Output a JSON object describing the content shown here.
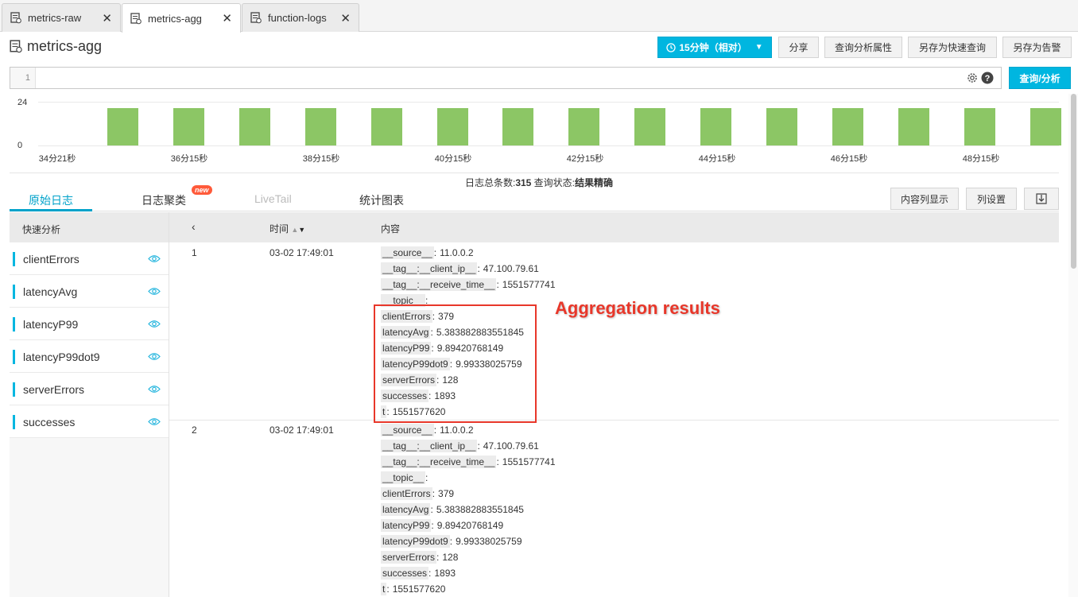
{
  "tabs": [
    {
      "label": "metrics-raw"
    },
    {
      "label": "metrics-agg"
    },
    {
      "label": "function-logs"
    }
  ],
  "header": {
    "title": "metrics-agg",
    "time_button": "15分钟（相对）",
    "share": "分享",
    "query_props": "查询分析属性",
    "save_quick": "另存为快速查询",
    "save_alert": "另存为告警"
  },
  "query": {
    "line_no": "1",
    "value": "",
    "submit": "查询/分析"
  },
  "histogram": {
    "y_ticks": [
      "24",
      "0"
    ],
    "x_ticks": [
      "34分21秒",
      "36分15秒",
      "38分15秒",
      "40分15秒",
      "42分15秒",
      "44分15秒",
      "46分15秒",
      "48分15秒"
    ],
    "bar_values": [
      24,
      24,
      24,
      24,
      24,
      24,
      24,
      24,
      24,
      24,
      24,
      24,
      24,
      24,
      24
    ],
    "bar_color": "#8cc665"
  },
  "summary": {
    "count_label": "日志总条数:",
    "count": "315",
    "status_label": " 查询状态:",
    "status": "结果精确"
  },
  "result_tabs": {
    "raw": "原始日志",
    "cluster": "日志聚类",
    "new_badge": "new",
    "livetail": "LiveTail",
    "chart": "统计图表",
    "content_col": "内容列显示",
    "col_settings": "列设置"
  },
  "quick_analysis": {
    "title": "快速分析",
    "fields": [
      "clientErrors",
      "latencyAvg",
      "latencyP99",
      "latencyP99dot9",
      "serverErrors",
      "successes"
    ]
  },
  "table": {
    "col_time": "时间",
    "col_content": "内容",
    "rows": [
      {
        "index": "1",
        "time": "03-02 17:49:01",
        "fields": [
          {
            "k": "__source__",
            "v": "11.0.0.2"
          },
          {
            "k": "__tag__:__client_ip__",
            "v": "47.100.79.61"
          },
          {
            "k": "__tag__:__receive_time__",
            "v": "1551577741"
          },
          {
            "k": "__topic__",
            "v": ""
          },
          {
            "k": "clientErrors",
            "v": "379"
          },
          {
            "k": "latencyAvg",
            "v": "5.383882883551845"
          },
          {
            "k": "latencyP99",
            "v": "9.89420768149"
          },
          {
            "k": "latencyP99dot9",
            "v": "9.99338025759"
          },
          {
            "k": "serverErrors",
            "v": "128"
          },
          {
            "k": "successes",
            "v": "1893"
          },
          {
            "k": "t",
            "v": "1551577620"
          }
        ]
      },
      {
        "index": "2",
        "time": "03-02 17:49:01",
        "fields": [
          {
            "k": "__source__",
            "v": "11.0.0.2"
          },
          {
            "k": "__tag__:__client_ip__",
            "v": "47.100.79.61"
          },
          {
            "k": "__tag__:__receive_time__",
            "v": "1551577741"
          },
          {
            "k": "__topic__",
            "v": ""
          },
          {
            "k": "clientErrors",
            "v": "379"
          },
          {
            "k": "latencyAvg",
            "v": "5.383882883551845"
          },
          {
            "k": "latencyP99",
            "v": "9.89420768149"
          },
          {
            "k": "latencyP99dot9",
            "v": "9.99338025759"
          },
          {
            "k": "serverErrors",
            "v": "128"
          },
          {
            "k": "successes",
            "v": "1893"
          },
          {
            "k": "t",
            "v": "1551577620"
          }
        ]
      }
    ]
  },
  "annotation": {
    "text": "Aggregation results",
    "color": "#e8372a"
  },
  "colors": {
    "accent": "#00b6e0",
    "active_tab": "#00a2ca",
    "field_bar": "#00b6e0"
  }
}
